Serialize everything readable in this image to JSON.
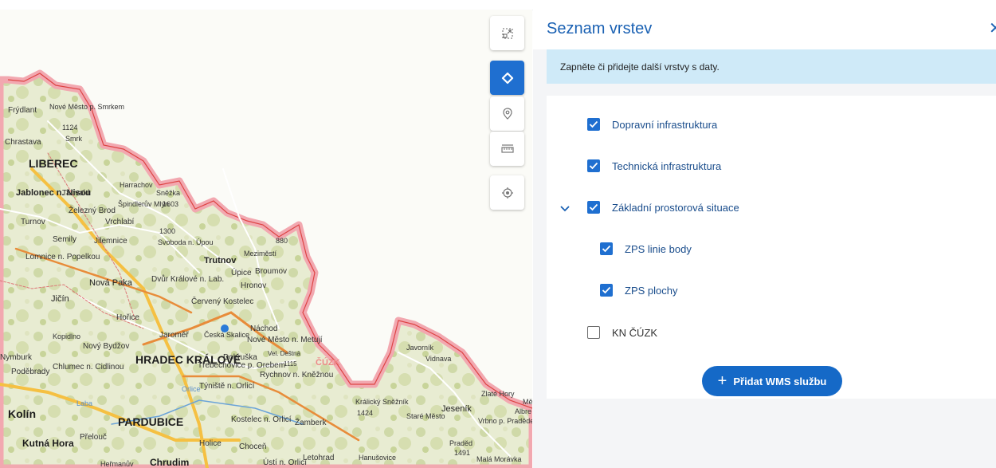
{
  "panel": {
    "title": "Seznam vrstev",
    "close_icon": "close-icon",
    "info_text": "Zapněte či přidejte další vrstvy s daty.",
    "add_button_label": "Přidat WMS službu"
  },
  "layers": [
    {
      "label": "Dopravní infrastruktura",
      "checked": true
    },
    {
      "label": "Technická infrastruktura",
      "checked": true
    },
    {
      "label": "Základní prostorová situace",
      "checked": true,
      "expanded": true
    },
    {
      "label": "ZPS linie body",
      "checked": true
    },
    {
      "label": "ZPS plochy",
      "checked": true
    },
    {
      "label": "KN ČÚZK",
      "checked": false
    }
  ],
  "toolbar": {
    "buttons": [
      "fullscreen-icon",
      "layers-icon",
      "pin-icon",
      "ruler-icon",
      "locate-icon"
    ],
    "active": "layers-icon"
  },
  "map": {
    "labels": [
      "Frýdlant",
      "Nové Město p. Smrkem",
      "1124",
      "Chrastava",
      "Smrk",
      "LIBEREC",
      "Jablonec n. Nisou",
      "Tanvald",
      "Harrachov",
      "Sněžka",
      "Špindlerův Mlýn",
      "1603",
      "Železný Brod",
      "Vrchlabí",
      "Turnov",
      "1300",
      "Semily",
      "Jilemnice",
      "Svoboda n. Úpou",
      "Lomnice n. Popelkou",
      "Trutnov",
      "Meziměstí",
      "880",
      "Úpice",
      "Broumov",
      "Nová Paka",
      "Dvůr Králové n. Lab.",
      "Jičín",
      "Hronov",
      "Červený Kostelec",
      "Hořice",
      "Kopidlno",
      "Jaroměř",
      "Česká Skalice",
      "Náchod",
      "Nové Město n. Metují",
      "Nový Bydžov",
      "HRADEC KRÁLOVÉ",
      "Dobruška",
      "Vel. Deštná",
      "1115",
      "ČÚZK",
      "Chlumec n. Cidlinou",
      "Třebechovice p. Orebem",
      "Rychnov n. Kněžnou",
      "Týniště n. Orlicí",
      "Poděbrady",
      "Orlice",
      "Javorník",
      "Vidnava",
      "Králický Sněžník",
      "1424",
      "Zlaté Hory",
      "Jeseník",
      "Kolín",
      "PARDUBICE",
      "Kostelec n. Orlicí",
      "Žamberk",
      "Staré Město",
      "Vrbno p. Pradědem",
      "Kutná Hora",
      "Přelouč",
      "Holice",
      "Choceň",
      "Letohrad",
      "Hanušovice",
      "Praděd",
      "1491",
      "Malá Morávka",
      "Chrudim",
      "Heřmanův",
      "Ústí n. Orlicí",
      "Mě",
      "Albre",
      "Laba",
      "Nymburk"
    ]
  }
}
